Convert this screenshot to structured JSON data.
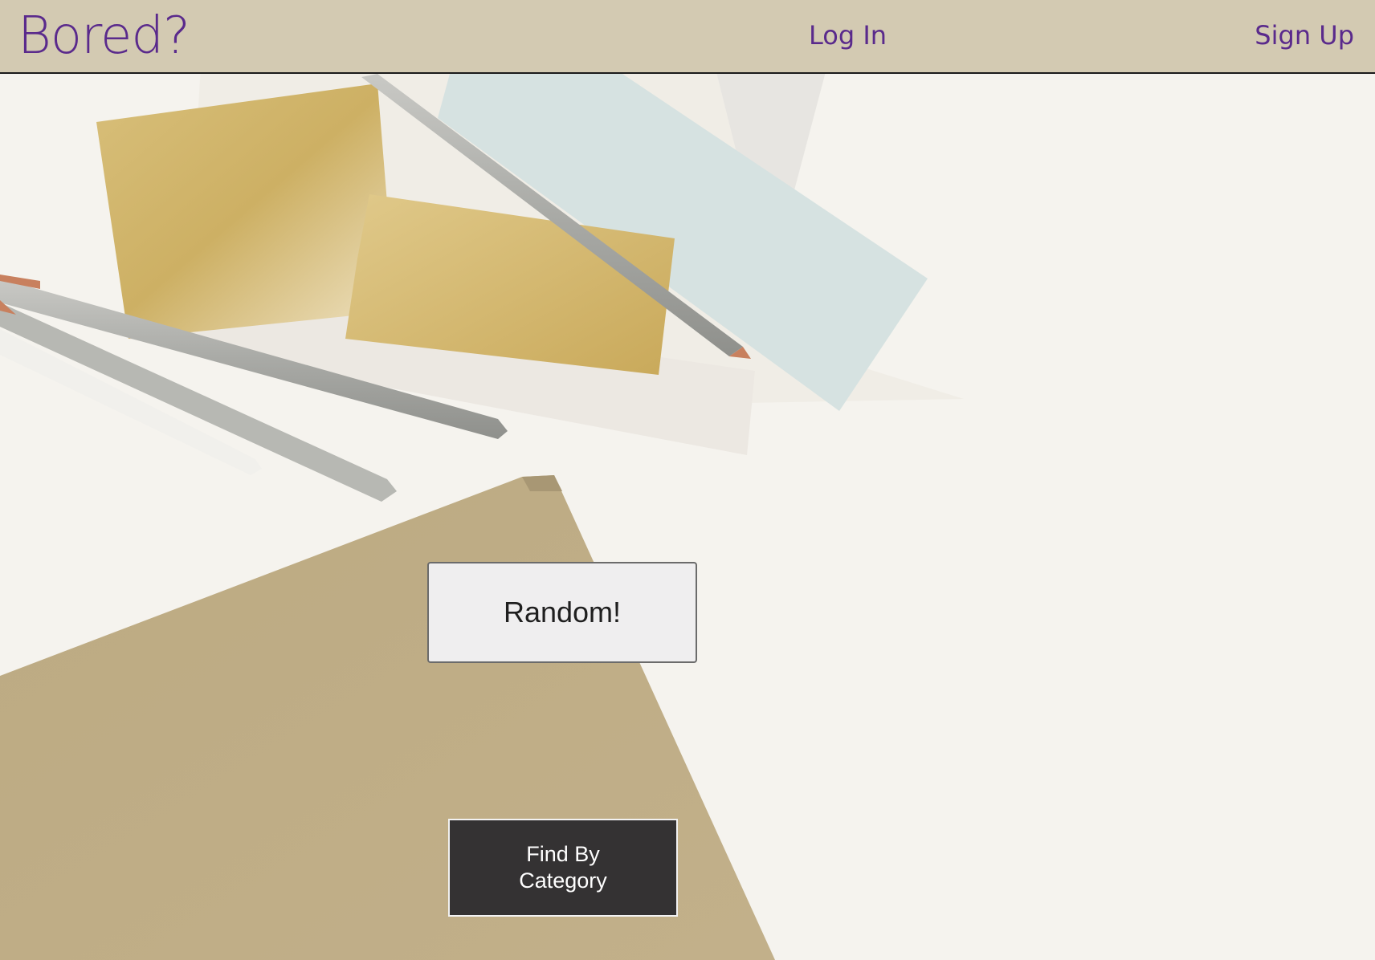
{
  "header": {
    "brand": "Bored?",
    "login_label": "Log In",
    "signup_label": "Sign Up"
  },
  "main": {
    "random_button_label": "Random!",
    "category_button_label": "Find By Category"
  },
  "colors": {
    "header_bg": "#d3cab2",
    "brand_purple": "#5a2a8c",
    "random_button_bg": "#efeeef",
    "category_button_bg": "#343233"
  }
}
